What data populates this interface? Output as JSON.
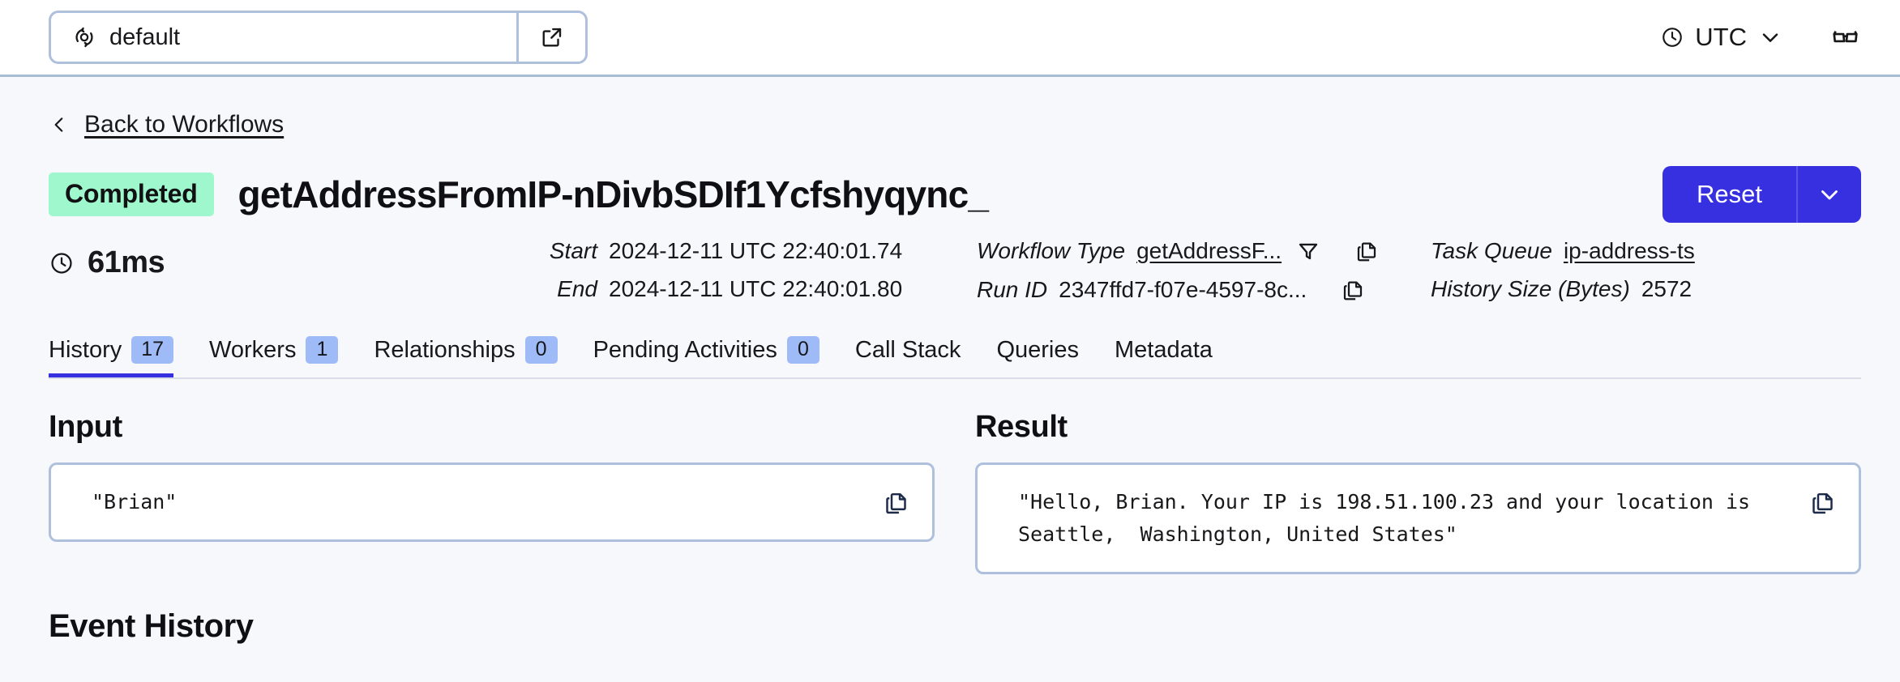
{
  "topbar": {
    "namespace": {
      "value": "default",
      "icon": "namespace-sync-icon",
      "external_link_icon": "external-link-icon"
    },
    "timezone": {
      "label": "UTC",
      "clock_icon": "clock-icon",
      "chevron_icon": "chevron-down-icon"
    },
    "reading_mode_icon": "glasses-icon"
  },
  "breadcrumb": {
    "back_label": "Back to Workflows",
    "back_icon": "chevron-left-icon"
  },
  "workflow": {
    "status": "Completed",
    "title": "getAddressFromIP-nDivbSDIf1Ycfshyqync_",
    "duration": "61ms",
    "duration_icon": "clock-icon",
    "actions": {
      "reset_label": "Reset",
      "reset_caret_icon": "chevron-down-icon"
    },
    "meta": {
      "start_label": "Start",
      "start_value": "2024-12-11 UTC 22:40:01.74",
      "end_label": "End",
      "end_value": "2024-12-11 UTC 22:40:01.80",
      "workflow_type_label": "Workflow Type",
      "workflow_type_value": "getAddressF...",
      "run_id_label": "Run ID",
      "run_id_value": "2347ffd7-f07e-4597-8c...",
      "task_queue_label": "Task Queue",
      "task_queue_value": "ip-address-ts",
      "history_size_label": "History Size (Bytes)",
      "history_size_value": "2572",
      "filter_icon": "filter-icon",
      "copy_icon": "copy-icon"
    }
  },
  "tabs": [
    {
      "label": "History",
      "badge": "17",
      "active": true
    },
    {
      "label": "Workers",
      "badge": "1",
      "active": false
    },
    {
      "label": "Relationships",
      "badge": "0",
      "active": false
    },
    {
      "label": "Pending Activities",
      "badge": "0",
      "active": false
    },
    {
      "label": "Call Stack",
      "badge": null,
      "active": false
    },
    {
      "label": "Queries",
      "badge": null,
      "active": false
    },
    {
      "label": "Metadata",
      "badge": null,
      "active": false
    }
  ],
  "panels": {
    "input": {
      "title": "Input",
      "content": "\"Brian\"",
      "copy_icon": "copy-icon"
    },
    "result": {
      "title": "Result",
      "content": "\"Hello, Brian. Your IP is 198.51.100.23 and your location is\nSeattle,  Washington, United States\"",
      "copy_icon": "copy-icon"
    }
  },
  "event_history": {
    "title": "Event History"
  },
  "colors": {
    "accent_blue": "#3730E0",
    "status_green": "#9FF8CD",
    "badge_blue": "#9EBBF8",
    "border_blue": "#AEC0DC",
    "page_bg": "#F7F8FC"
  }
}
